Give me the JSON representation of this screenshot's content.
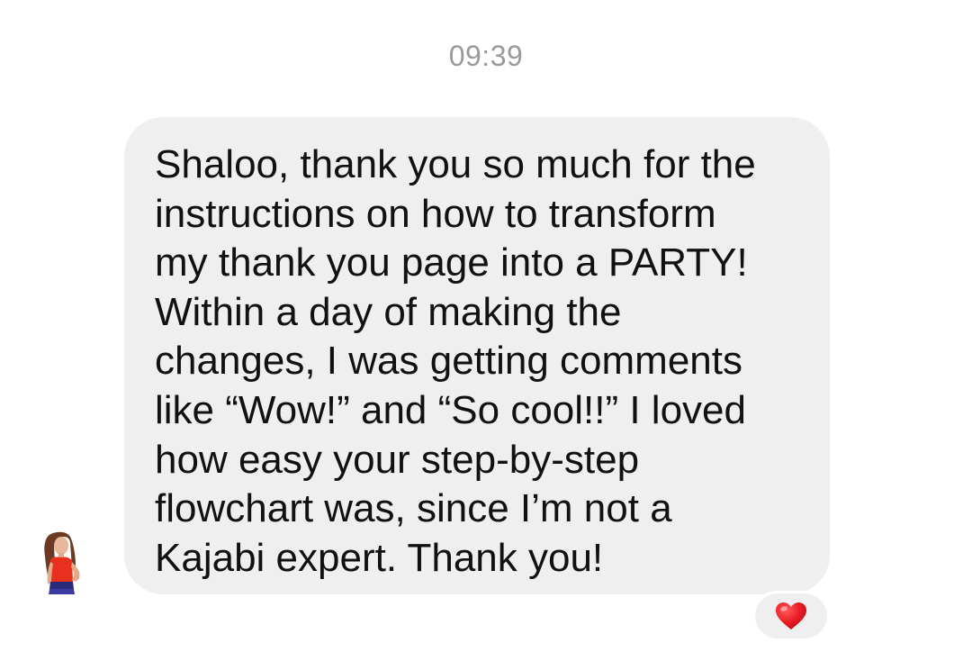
{
  "conversation": {
    "timestamp": "09:39",
    "message": {
      "text": "Shaloo, thank you so much for the\ninstructions on how to transform\nmy thank you page into a PARTY!\nWithin a day of making the\nchanges, I was getting comments\nlike “Wow!” and “So cool!!” I loved\nhow easy your step-by-step\nflowchart was, since I’m not a\nKajabi expert. Thank you!",
      "reaction_icon": "heart-icon",
      "reaction_color": "#ed1c24",
      "bubble_color": "#efefef"
    },
    "sender": {
      "avatar_icon": "avatar"
    }
  }
}
